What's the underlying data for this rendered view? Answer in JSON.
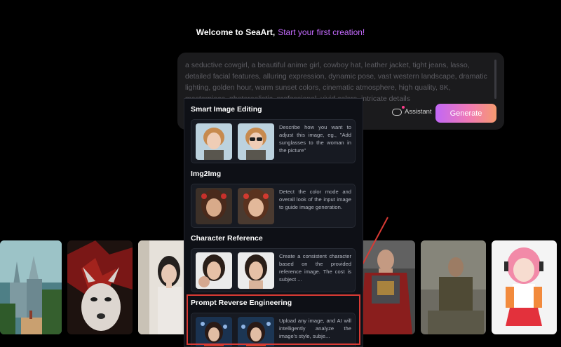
{
  "welcome": {
    "title": "Welcome to SeaArt,",
    "highlight": "Start your first creation!"
  },
  "prompt": {
    "text": "a seductive cowgirl, a beautiful anime girl, cowboy hat, leather jacket, tight jeans, lasso, detailed facial features, alluring expression, dynamic pose, vast western landscape, dramatic lighting, golden hour, warm sunset colors, cinematic atmosphere, high quality, 8K, masterpiece, photorealistic, professional, vivid colors, intricate details"
  },
  "toolbar": {
    "assistant_label": "Assistant",
    "generate_label": "Generate"
  },
  "dropdown": {
    "sections": [
      {
        "title": "Smart Image Editing",
        "description": "Describe how you want to adjust this image, eg., \"Add sunglasses to the woman in the picture\""
      },
      {
        "title": "Img2Img",
        "description": "Detect the color mode and overall look of the input image to guide image generation."
      },
      {
        "title": "Character Reference",
        "description": "Create a consistent character based on the provided reference image. The cost is subject ..."
      },
      {
        "title": "Prompt Reverse Engineering",
        "description": "Upload any image, and AI will intelligently analyze the image's style, subje..."
      }
    ]
  },
  "colors": {
    "accent_purple": "#c56bff",
    "generate_gradient_start": "#c167f6",
    "generate_gradient_end": "#f69a6f",
    "annotation_red": "#d93a34",
    "dropdown_bg": "#0e1016"
  },
  "icons": {
    "assistant": "assistant-icon"
  }
}
